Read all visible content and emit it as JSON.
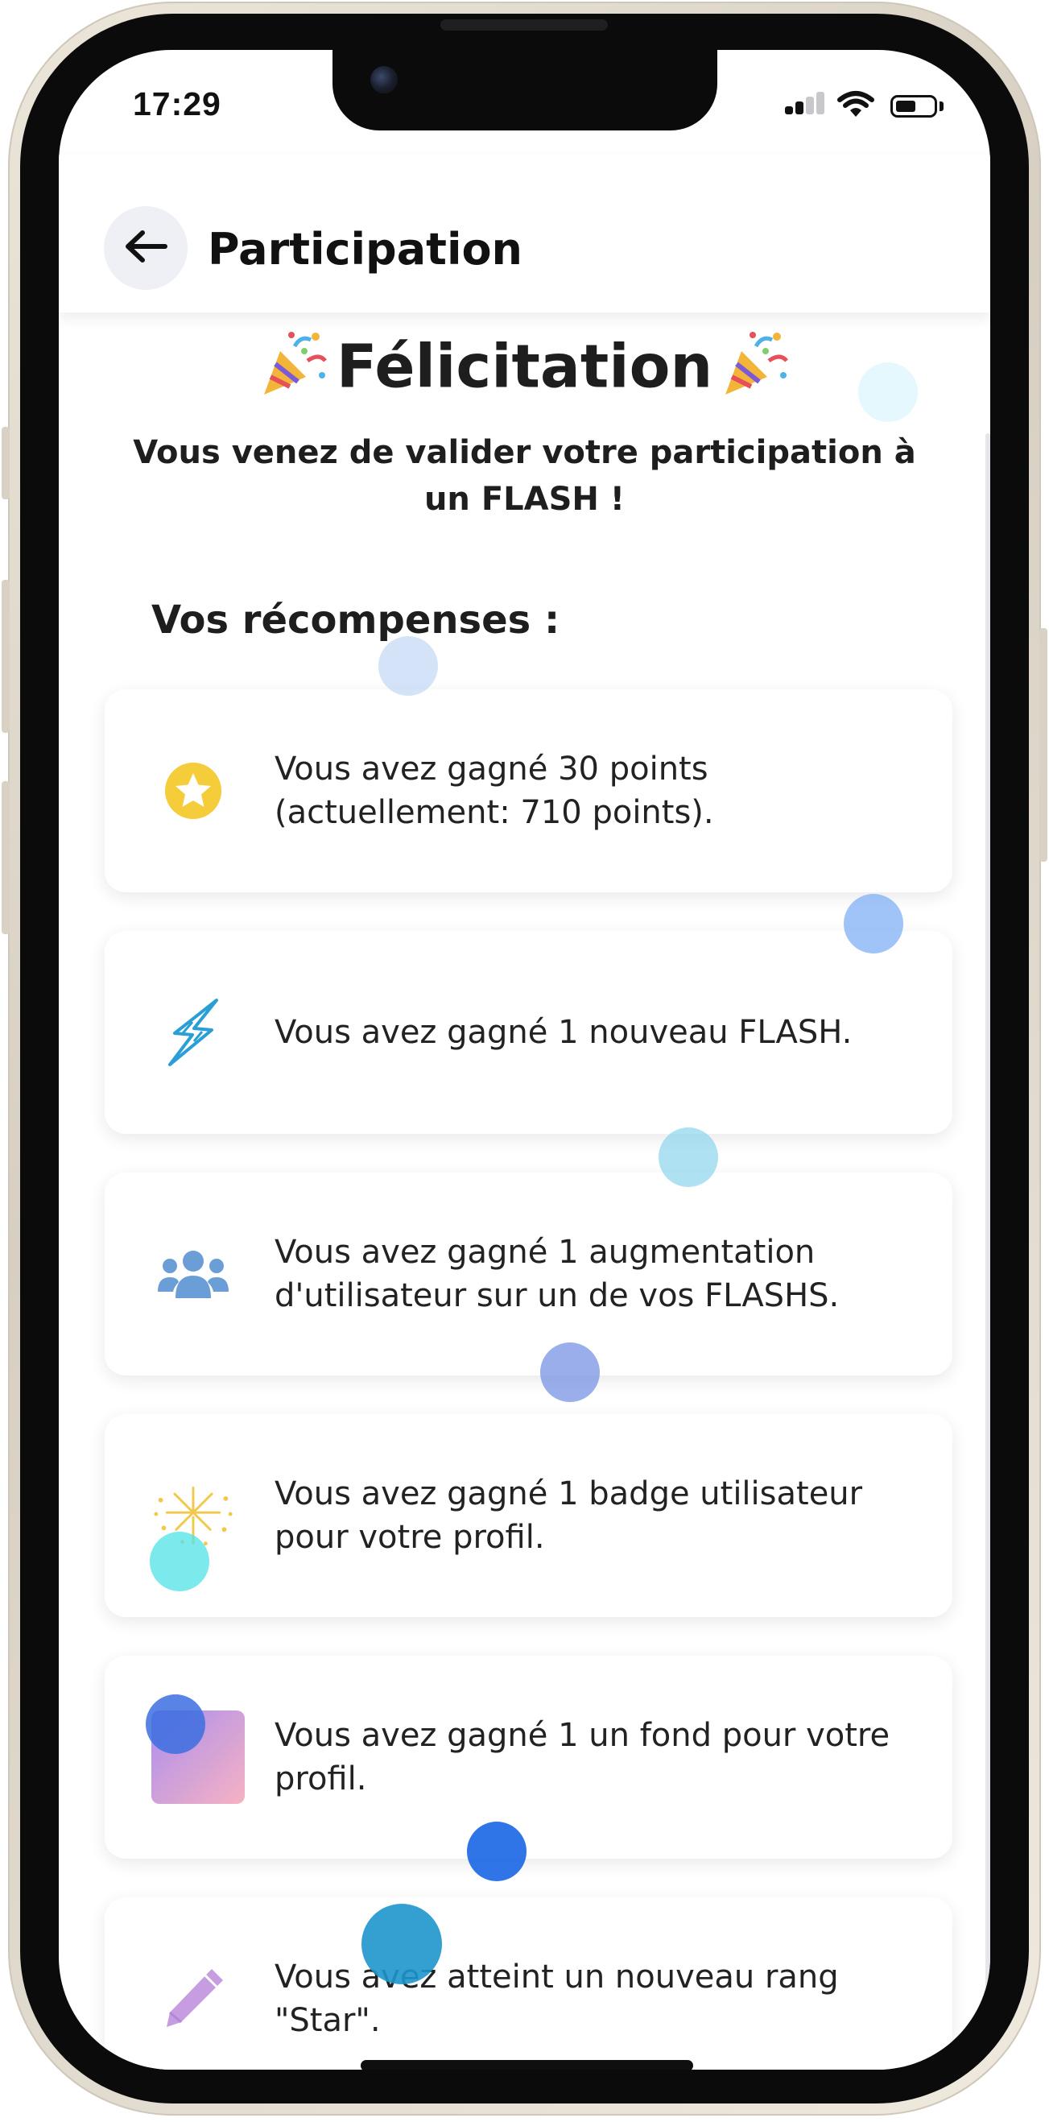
{
  "status_bar": {
    "time": "17:29"
  },
  "header": {
    "title": "Participation"
  },
  "congrats": {
    "title": "Félicitation",
    "message": "Vous venez de valider votre participation à un FLASH !"
  },
  "rewards": {
    "section_title": "Vos récompenses :",
    "items": [
      {
        "icon": "star-badge-icon",
        "text": "Vous avez gagné 30 points (actuellement: 710 points)."
      },
      {
        "icon": "lightning-icon",
        "text": "Vous avez gagné 1 nouveau FLASH."
      },
      {
        "icon": "users-group-icon",
        "text": "Vous avez gagné 1 augmentation d'utilisateur sur un de vos FLASHS."
      },
      {
        "icon": "fireworks-icon",
        "text": "Vous avez gagné 1 badge utilisateur pour votre profil."
      },
      {
        "icon": "gradient-background-icon",
        "text": "Vous avez gagné 1 un fond pour votre profil."
      },
      {
        "icon": "pencil-icon",
        "text": "Vous avez atteint un nouveau rang \"Star\"."
      }
    ]
  },
  "colors": {
    "star": "#f5cc3a",
    "lightning": "#2a9fd6",
    "users": "#6b9ed6",
    "fireworks": "#f2c84b",
    "pencil": "#c59de0",
    "gradient_from": "#a98ef0",
    "gradient_to": "#f7b2c2"
  }
}
